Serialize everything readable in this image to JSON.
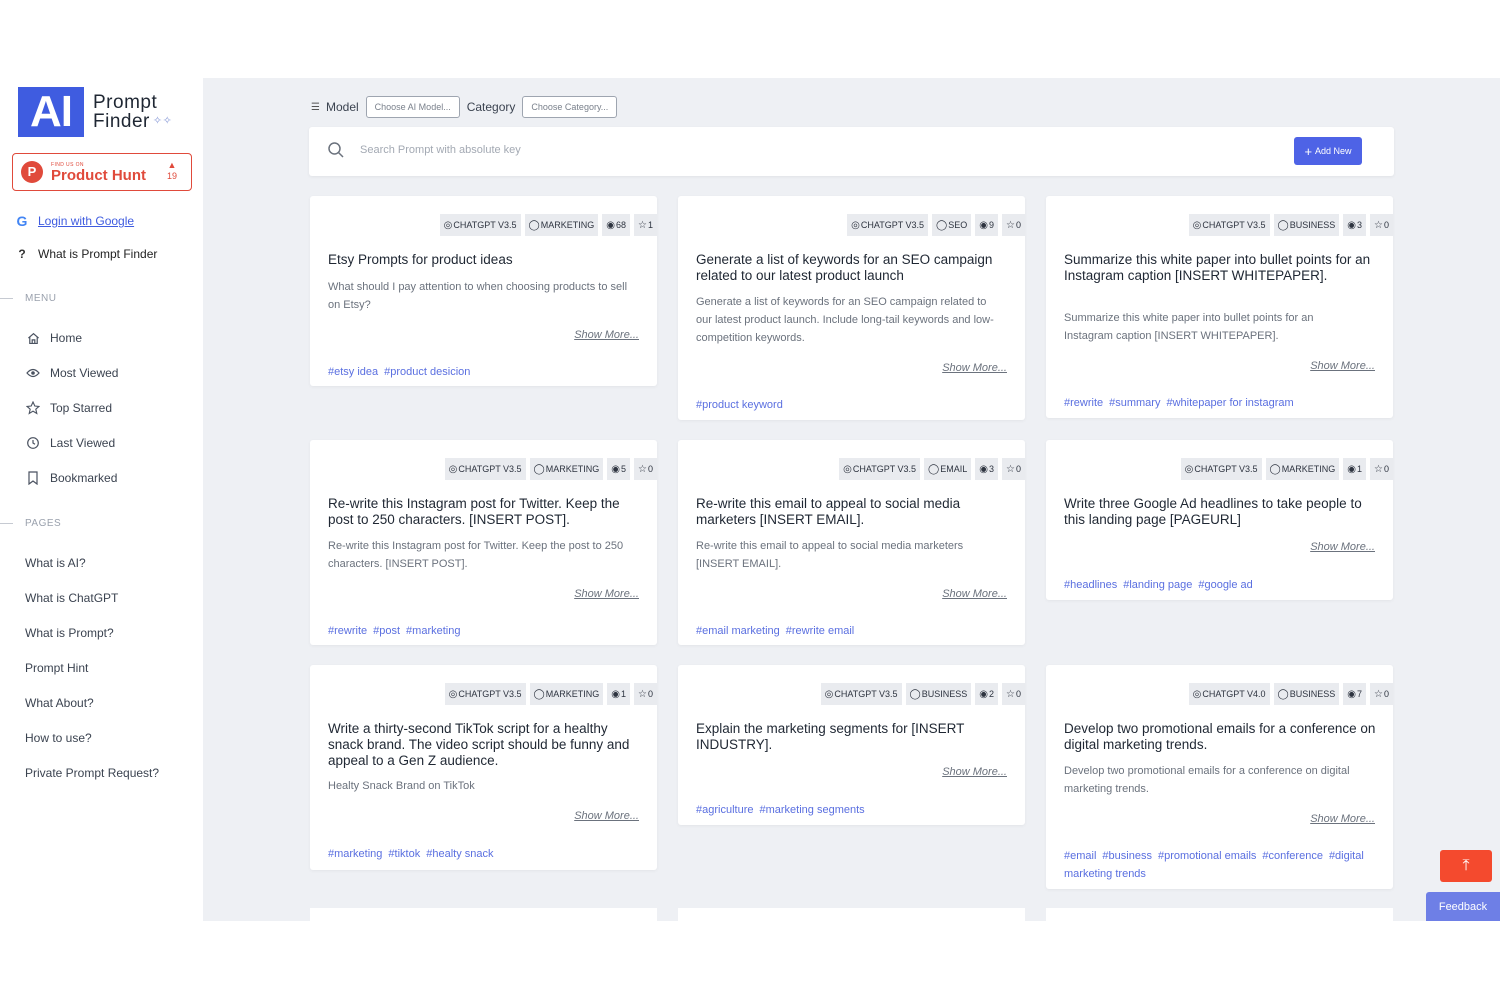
{
  "brand": {
    "logo_mark": "AI",
    "line1": "Prompt",
    "line2": "Finder"
  },
  "product_hunt": {
    "small": "FIND US ON",
    "name": "Product Hunt",
    "count": "19",
    "letter": "P"
  },
  "auth": {
    "google_label": "Login with Google"
  },
  "about_label": "What is Prompt Finder",
  "menu": {
    "title": "MENU",
    "items": [
      {
        "label": "Home",
        "icon": "home-icon"
      },
      {
        "label": "Most Viewed",
        "icon": "eye-icon"
      },
      {
        "label": "Top Starred",
        "icon": "star-icon"
      },
      {
        "label": "Last Viewed",
        "icon": "history-icon"
      },
      {
        "label": "Bookmarked",
        "icon": "bookmark-icon"
      }
    ]
  },
  "pages": {
    "title": "PAGES",
    "items": [
      "What is AI?",
      "What is ChatGPT",
      "What is Prompt?",
      "Prompt Hint",
      "What About?",
      "How to use?",
      "Private Prompt Request?"
    ]
  },
  "filters": {
    "model_label": "Model",
    "model_placeholder": "Choose AI Model...",
    "category_label": "Category",
    "category_placeholder": "Choose Category..."
  },
  "search": {
    "placeholder": "Search Prompt with absolute key",
    "add_label": "Add New"
  },
  "show_more": "Show More...",
  "cards": [
    {
      "model": "CHATGPT V3.5",
      "category": "MARKETING",
      "views": "68",
      "stars": "1",
      "title": "Etsy Prompts for product ideas",
      "desc": "What should I pay attention to when choosing products to sell on Etsy?",
      "tags": [
        "#etsy idea",
        "#product desicion"
      ]
    },
    {
      "model": "CHATGPT V3.5",
      "category": "SEO",
      "views": "9",
      "stars": "0",
      "title": "Generate a list of keywords for an SEO campaign related to our latest product launch",
      "desc": "Generate a list of keywords for an SEO campaign related to our latest product launch. Include long-tail keywords and low-competition keywords.",
      "tags": [
        "#product keyword"
      ]
    },
    {
      "model": "CHATGPT V3.5",
      "category": "BUSINESS",
      "views": "3",
      "stars": "0",
      "title": "Summarize this white paper into bullet points for an Instagram caption [INSERT WHITEPAPER].",
      "desc": "Summarize this white paper into bullet points for an Instagram caption [INSERT WHITEPAPER].",
      "tags": [
        "#rewrite",
        "#summary",
        "#whitepaper for instagram"
      ]
    },
    {
      "model": "CHATGPT V3.5",
      "category": "MARKETING",
      "views": "5",
      "stars": "0",
      "title": "Re-write this Instagram post for Twitter. Keep the post to 250 characters. [INSERT POST].",
      "desc": "Re-write this Instagram post for Twitter. Keep the post to 250 characters. [INSERT POST].",
      "tags": [
        "#rewrite",
        "#post",
        "#marketing"
      ]
    },
    {
      "model": "CHATGPT V3.5",
      "category": "EMAIL",
      "views": "3",
      "stars": "0",
      "title": "Re-write this email to appeal to social media marketers [INSERT EMAIL].",
      "desc": "Re-write this email to appeal to social media marketers [INSERT EMAIL].",
      "tags": [
        "#email marketing",
        "#rewrite email"
      ]
    },
    {
      "model": "CHATGPT V3.5",
      "category": "MARKETING",
      "views": "1",
      "stars": "0",
      "title": "Write three Google Ad headlines to take people to this landing page [PAGEURL]",
      "desc": "",
      "tags": [
        "#headlines",
        "#landing page",
        "#google ad"
      ]
    },
    {
      "model": "CHATGPT V3.5",
      "category": "MARKETING",
      "views": "1",
      "stars": "0",
      "title": "Write a thirty-second TikTok script for a healthy snack brand. The video script should be funny and appeal to a Gen Z audience.",
      "desc": "Healty Snack Brand on TikTok",
      "tags": [
        "#marketing",
        "#tiktok",
        "#healty snack"
      ]
    },
    {
      "model": "CHATGPT V3.5",
      "category": "BUSINESS",
      "views": "2",
      "stars": "0",
      "title": "Explain the marketing segments for [INSERT INDUSTRY].",
      "desc": "",
      "tags": [
        "#agriculture",
        "#marketing segments"
      ]
    },
    {
      "model": "CHATGPT V4.0",
      "category": "BUSINESS",
      "views": "7",
      "stars": "0",
      "title": "Develop two promotional emails for a conference on digital marketing trends.",
      "desc": "Develop two promotional emails for a conference on digital marketing trends.",
      "tags": [
        "#email",
        "#business",
        "#promotional emails",
        "#conference",
        "#digital marketing trends"
      ]
    }
  ],
  "feedback_label": "Feedback"
}
